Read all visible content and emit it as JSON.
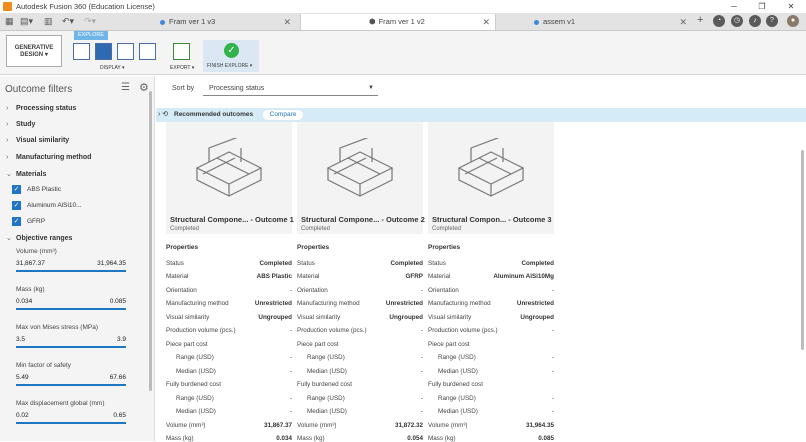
{
  "window": {
    "title": "Autodesk Fusion 360 (Education License)"
  },
  "tabs": [
    {
      "label": "Fram ver 1 v3",
      "active": false
    },
    {
      "label": "Fram ver 1 v2",
      "active": true
    },
    {
      "label": "assem v1",
      "active": false
    }
  ],
  "toolbar": {
    "generative_design": "GENERATIVE DESIGN",
    "explore": "EXPLORE",
    "display": "DISPLAY ▾",
    "export": "EXPORT ▾",
    "finish_explore": "FINISH EXPLORE ▾"
  },
  "filters": {
    "title": "Outcome filters",
    "sections": [
      "Processing status",
      "Study",
      "Visual similarity",
      "Manufacturing method",
      "Materials",
      "Objective ranges"
    ],
    "materials": [
      "ABS Plastic",
      "Aluminum AlSi10...",
      "GFRP"
    ],
    "ranges": [
      {
        "label": "Volume (mm³)",
        "min": "31,867.37",
        "max": "31,964.35"
      },
      {
        "label": "Mass (kg)",
        "min": "0.034",
        "max": "0.085"
      },
      {
        "label": "Max von Mises stress (MPa)",
        "min": "3.5",
        "max": "3.9"
      },
      {
        "label": "Min factor of safety",
        "min": "5.49",
        "max": "67.66"
      },
      {
        "label": "Max displacement global (mm)",
        "min": "0.02",
        "max": "0.65"
      }
    ]
  },
  "sort": {
    "label": "Sort by",
    "value": "Processing status"
  },
  "recommended": {
    "label": "Recommended outcomes",
    "compare": "Compare"
  },
  "outcomes": [
    {
      "name": "Structural Compone... - Outcome 1",
      "status": "Completed"
    },
    {
      "name": "Structural Compone... - Outcome 2",
      "status": "Completed"
    },
    {
      "name": "Structural Compon... - Outcome 3",
      "status": "Completed"
    }
  ],
  "properties": {
    "header": "Properties",
    "labels": [
      "Status",
      "Material",
      "Orientation",
      "Manufacturing method",
      "Visual similarity",
      "Production volume (pcs.)",
      "Piece part cost",
      "Range (USD)",
      "Median (USD)",
      "Fully burdened cost",
      "Range (USD)",
      "Median (USD)",
      "Volume (mm³)",
      "Mass (kg)"
    ],
    "values": [
      [
        "Completed",
        "ABS Plastic",
        "-",
        "Unrestricted",
        "Ungrouped",
        "-",
        "",
        "-",
        "-",
        "",
        "-",
        "-",
        "31,867.37",
        "0.034"
      ],
      [
        "Completed",
        "GFRP",
        "-",
        "Unrestricted",
        "Ungrouped",
        "-",
        "",
        "-",
        "-",
        "",
        "-",
        "-",
        "31,872.32",
        "0.054"
      ],
      [
        "Completed",
        "Aluminum AlSi10Mg",
        "-",
        "Unrestricted",
        "Ungrouped",
        "-",
        "",
        "-",
        "-",
        "",
        "-",
        "-",
        "31,964.35",
        "0.085"
      ]
    ]
  }
}
